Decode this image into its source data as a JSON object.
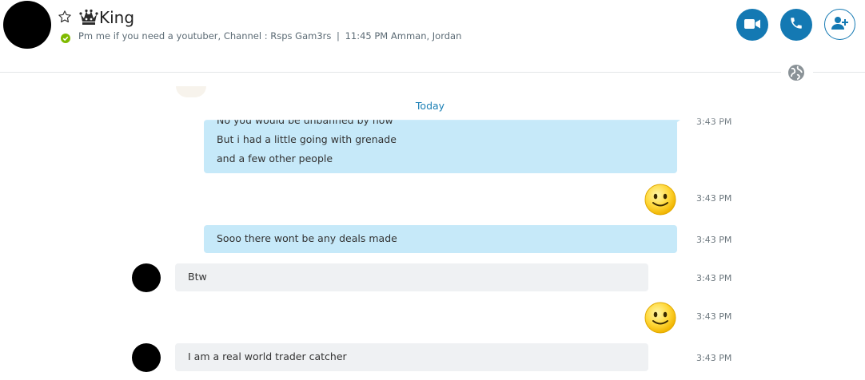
{
  "header": {
    "contact_name": "King",
    "mood_message": "Pm me if you need a youtuber, Channel : Rsps Gam3rs",
    "separator": "|",
    "local_time": "11:45 PM Amman, Jordan",
    "status": "online",
    "icons": {
      "favorite": "star-outline-icon",
      "crown": "crown-icon",
      "video": "video-call-icon",
      "audio": "phone-call-icon",
      "add": "add-contact-icon",
      "globe": "globe-icon"
    }
  },
  "divider": {
    "label": "Today"
  },
  "messages": [
    {
      "direction": "outgoing",
      "lines": [
        "No you would be unbanned by now",
        "But i had a little going with grenade",
        "and a few other people"
      ],
      "time": "3:43 PM"
    },
    {
      "direction": "outgoing",
      "emoticon": "smiley-icon",
      "time": "3:43 PM"
    },
    {
      "direction": "outgoing",
      "text": "Sooo there wont be any deals made",
      "time": "3:43 PM"
    },
    {
      "direction": "incoming",
      "text": "Btw",
      "time": "3:43 PM"
    },
    {
      "direction": "outgoing",
      "emoticon": "smiley-icon",
      "time": "3:43 PM"
    },
    {
      "direction": "incoming",
      "text": "I am a real world trader catcher",
      "time": "3:43 PM"
    }
  ],
  "colors": {
    "accent": "#1479b3",
    "outgoing_bubble": "#c6e9f9",
    "incoming_bubble": "#eff1f3",
    "online": "#7fba00",
    "today_label": "#1a7fb5"
  }
}
